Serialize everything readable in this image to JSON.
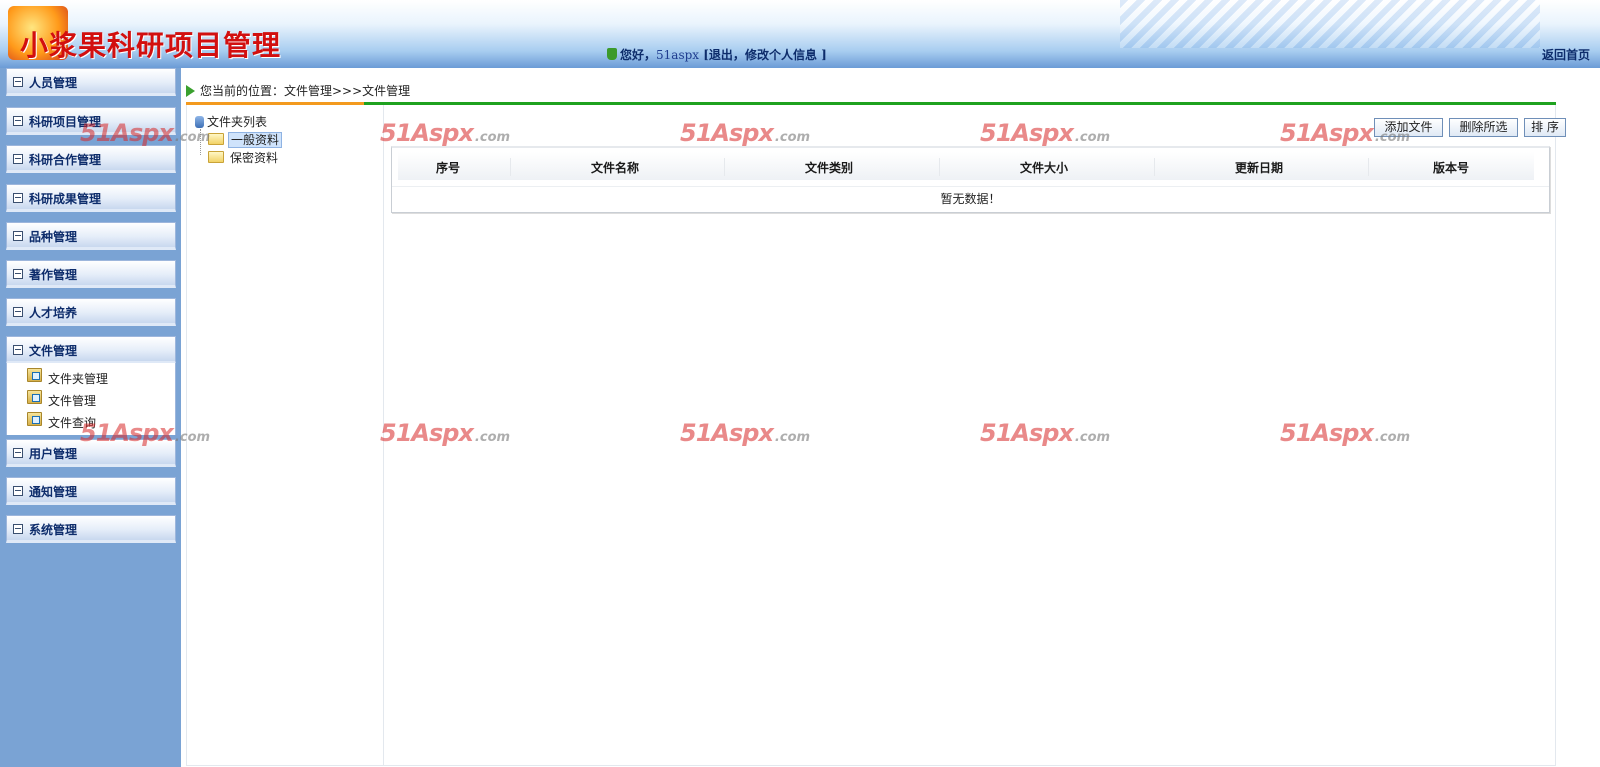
{
  "header": {
    "app_title": "小浆果科研项目管理",
    "greeting": "您好，",
    "username": "51aspx",
    "actions_open": " [",
    "logout": "退出",
    "sep": "，",
    "edit_profile": "修改个人信息",
    "actions_close": " ]",
    "home_link": "返回首页"
  },
  "sidebar": {
    "menus": [
      {
        "label": "人员管理"
      },
      {
        "label": "科研项目管理"
      },
      {
        "label": "科研合作管理"
      },
      {
        "label": "科研成果管理"
      },
      {
        "label": "品种管理"
      },
      {
        "label": "著作管理"
      },
      {
        "label": "人才培养"
      },
      {
        "label": "文件管理"
      },
      {
        "label": "用户管理"
      },
      {
        "label": "通知管理"
      },
      {
        "label": "系统管理"
      }
    ],
    "submenu": [
      {
        "label": "文件夹管理"
      },
      {
        "label": "文件管理"
      },
      {
        "label": "文件查询"
      }
    ]
  },
  "breadcrumb": "您当前的位置：文件管理>>>文件管理",
  "tree": {
    "root": "文件夹列表",
    "nodes": [
      {
        "label": "一般资料",
        "selected": true
      },
      {
        "label": "保密资料",
        "selected": false
      }
    ]
  },
  "toolbar": {
    "add": "添加文件",
    "delete": "删除所选",
    "sort": "排 序"
  },
  "grid": {
    "columns": [
      "序号",
      "文件名称",
      "文件类别",
      "文件大小",
      "更新日期",
      "版本号"
    ],
    "empty_text": "暂无数据！"
  },
  "watermark": {
    "main": "51Aspx",
    "suffix": ".com"
  },
  "colors": {
    "sidebar_bg": "#7aa3d4",
    "accent_orange": "#f39a1e",
    "accent_green": "#1fa21f",
    "title_red": "#d20f0f"
  }
}
